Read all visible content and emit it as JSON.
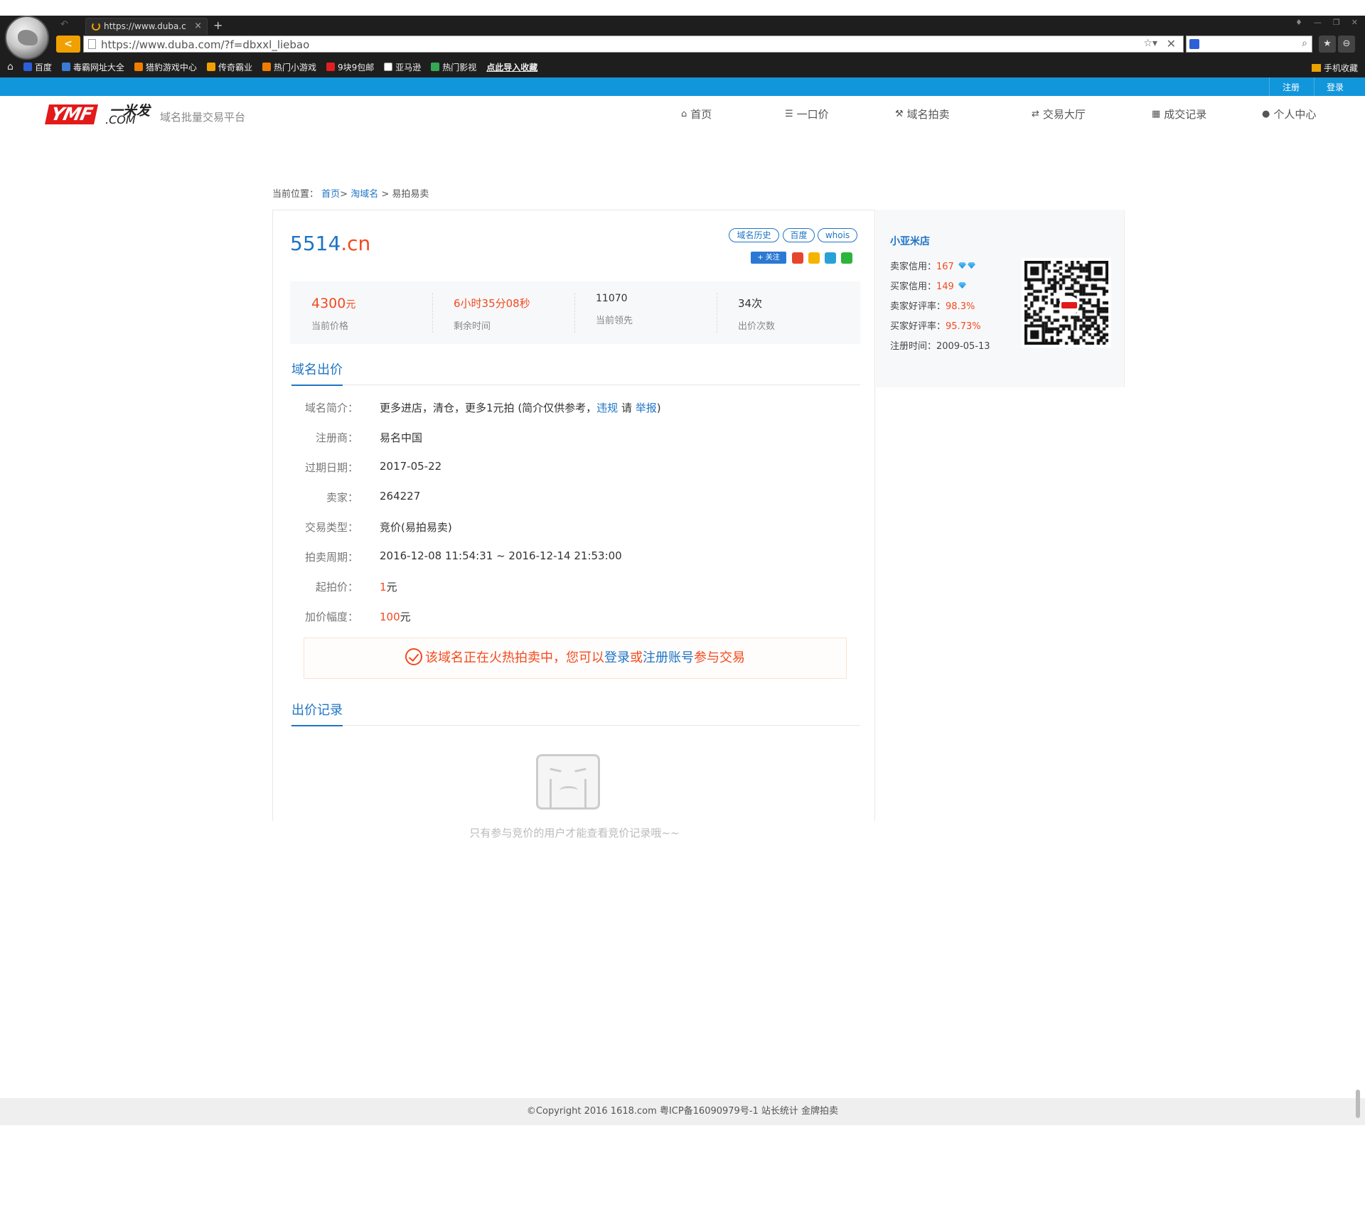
{
  "browser": {
    "tab_title": "https://www.duba.c",
    "tab_close": "×",
    "new_tab": "+",
    "back": "<",
    "url": "https://www.duba.com/?f=dbxxl_liebao",
    "favorites": [
      {
        "label": "百度",
        "color": "#2e5fd8"
      },
      {
        "label": "毒霸网址大全",
        "color": "#3a7bd5"
      },
      {
        "label": "猎豹游戏中心",
        "color": "#f07c00"
      },
      {
        "label": "传奇霸业",
        "color": "#f0a000"
      },
      {
        "label": "热门小游戏",
        "color": "#f07c00"
      },
      {
        "label": "9块9包邮",
        "color": "#e02020"
      },
      {
        "label": "亚马逊",
        "color": "#ffffff"
      },
      {
        "label": "热门影视",
        "color": "#34a853"
      }
    ],
    "import_fav": "点此导入收藏",
    "mobile_fav": "手机收藏"
  },
  "topbar": {
    "register": "注册",
    "login": "登录"
  },
  "site": {
    "logo_text": "YMF",
    "logo_cn": "一米发",
    "logo_com": ".COM",
    "tagline": "域名批量交易平台"
  },
  "nav": [
    {
      "label": "首页",
      "icon": "home-icon",
      "glyph": "⌂"
    },
    {
      "label": "一口价",
      "icon": "list-icon",
      "glyph": "☰"
    },
    {
      "label": "域名拍卖",
      "icon": "gavel-icon",
      "glyph": "⚒"
    },
    {
      "label": "交易大厅",
      "icon": "exchange-icon",
      "glyph": "⇄"
    },
    {
      "label": "成交记录",
      "icon": "archive-icon",
      "glyph": "▦"
    },
    {
      "label": "个人中心",
      "icon": "user-icon",
      "glyph": "●"
    }
  ],
  "breadcrumb": {
    "prefix": "当前位置：",
    "home": "首页",
    "sep1": ">",
    "category": "淘域名",
    "sep2": ">",
    "current": "易拍易卖"
  },
  "domain": {
    "name": "5514",
    "tld": ".cn",
    "tags": [
      "域名历史",
      "百度",
      "whois"
    ],
    "follow": "+ 关注"
  },
  "stats": {
    "price_value": "4300",
    "price_unit": "元",
    "price_label": "当前价格",
    "time_value": "6小时35分08秒",
    "time_label": "剩余时间",
    "leader_value": "11070",
    "leader_label": "当前领先",
    "bids_value": "34次",
    "bids_label": "出价次数"
  },
  "section_bid": "域名出价",
  "info": {
    "intro_label": "域名简介：",
    "intro_text": "更多进店，清仓，更多1元拍 (简介仅供参考，",
    "intro_violation": "违规",
    "intro_please": " 请 ",
    "intro_report": "举报",
    "intro_close": ")",
    "registrar_label": "注册商：",
    "registrar": "易名中国",
    "expire_label": "过期日期：",
    "expire": "2017-05-22",
    "seller_label": "卖家：",
    "seller": "264227",
    "type_label": "交易类型：",
    "type": "竞价(易拍易卖)",
    "period_label": "拍卖周期：",
    "period": "2016-12-08 11:54:31 ~ 2016-12-14 21:53:00",
    "start_label": "起拍价：",
    "start_value": "1",
    "start_unit": "元",
    "inc_label": "加价幅度：",
    "inc_value": "100",
    "inc_unit": "元"
  },
  "notice": {
    "part1": "该域名正在火热拍卖中，您可以",
    "login": "登录",
    "or": "或",
    "register": "注册账号",
    "part2": "参与交易"
  },
  "section_records": "出价记录",
  "empty_text": "只有参与竞价的用户才能查看竞价记录哦~~",
  "seller_panel": {
    "shop": "小亚米店",
    "seller_credit_label": "卖家信用：",
    "seller_credit": "167",
    "seller_diamonds": 2,
    "buyer_credit_label": "买家信用：",
    "buyer_credit": "149",
    "buyer_diamonds": 1,
    "seller_rate_label": "卖家好评率：",
    "seller_rate": "98.3%",
    "buyer_rate_label": "买家好评率：",
    "buyer_rate": "95.73%",
    "reg_label": "注册时间：",
    "reg_date": "2009-05-13"
  },
  "footer": "©Copyright 2016 1618.com 粤ICP备16090979号-1 站长统计 金牌拍卖",
  "colors": {
    "accent": "#1f74c5",
    "price": "#f24a1f",
    "topbar": "#1296db",
    "brand": "#e21a1a"
  }
}
